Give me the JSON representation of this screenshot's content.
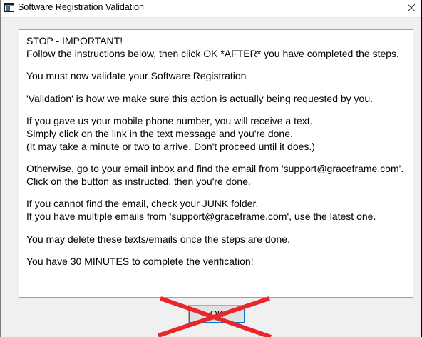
{
  "window": {
    "title": "Software Registration Validation",
    "close_glyph": "✕"
  },
  "message": {
    "paragraphs": [
      [
        "STOP - IMPORTANT!",
        "Follow the instructions below, then click OK *AFTER* you have completed the steps."
      ],
      [
        "You must now validate your Software Registration"
      ],
      [
        "'Validation' is how we make sure this action is actually being requested by you."
      ],
      [
        "If you gave us your mobile phone number, you will receive a text.",
        "Simply click on the link in the text message and you're done.",
        "(It may take a minute or two to arrive. Don't proceed until it does.)"
      ],
      [
        "Otherwise, go to your email inbox and find the email from 'support@graceframe.com'.",
        "Click on the button as instructed, then you're done."
      ],
      [
        "If you cannot find the email, check your JUNK folder.",
        "If you have multiple emails from 'support@graceframe.com', use the latest one."
      ],
      [
        "You may delete these texts/emails once the steps are done."
      ],
      [
        "You have 30 MINUTES to complete the verification!"
      ]
    ]
  },
  "buttons": {
    "ok_label": "OK"
  },
  "icons": {
    "app": "app-window-icon",
    "close": "close-icon",
    "overlay": "red-cross-mark"
  },
  "colors": {
    "cross": "#e8262b",
    "button_focus": "#0078d7"
  }
}
